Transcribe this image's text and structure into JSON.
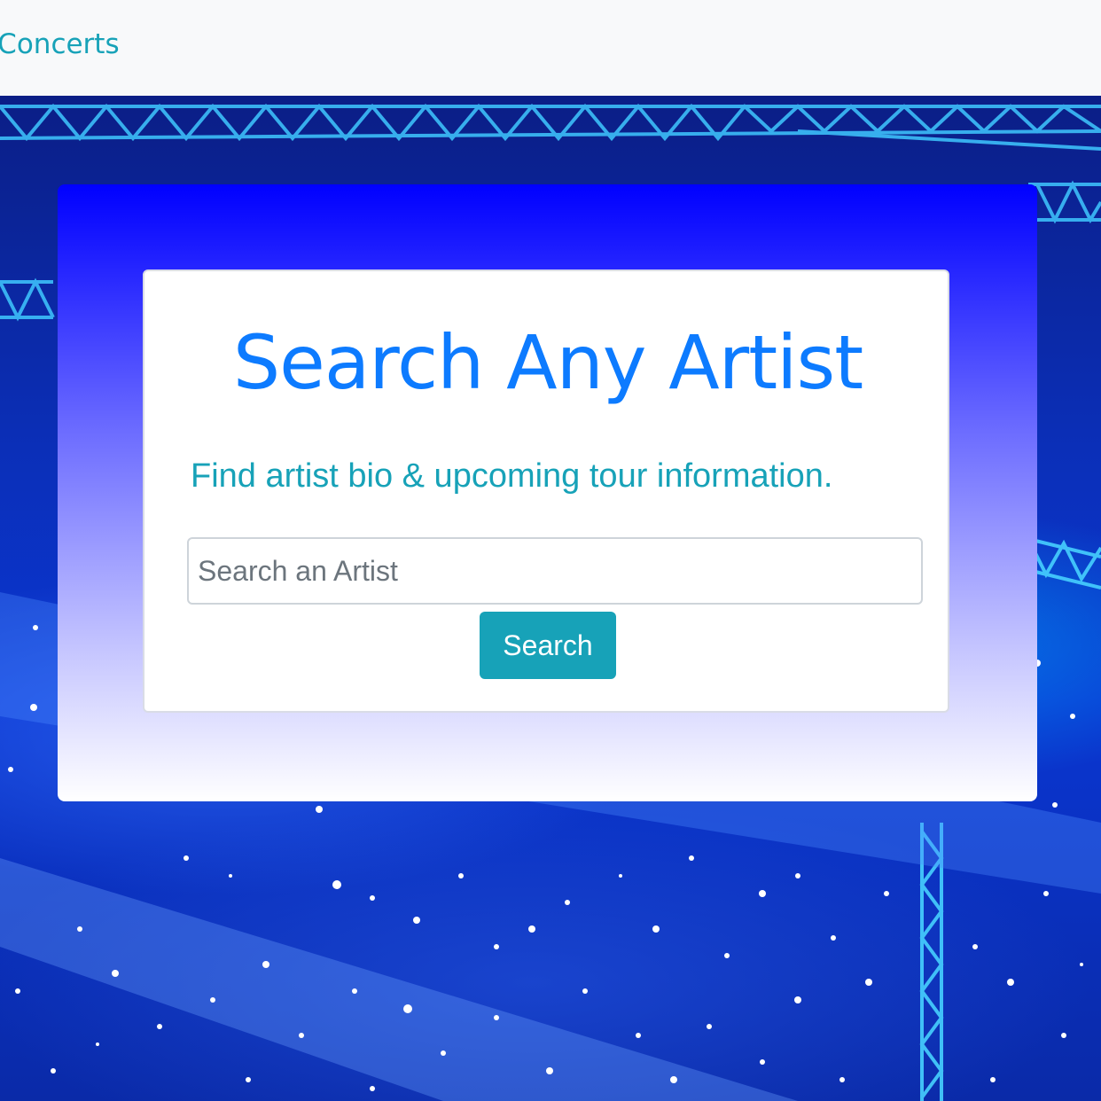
{
  "navbar": {
    "brand": "ng Concerts"
  },
  "hero": {
    "title": "Search Any Artist",
    "subtitle": "Find artist bio & upcoming tour information.",
    "search": {
      "placeholder": "Search an Artist",
      "value": ""
    },
    "search_button_label": "Search"
  },
  "colors": {
    "accent": "#17a2b8",
    "title": "#0d7bff",
    "jumbotron_top": "#0000ff",
    "navbar_bg": "#f8f9fa"
  }
}
